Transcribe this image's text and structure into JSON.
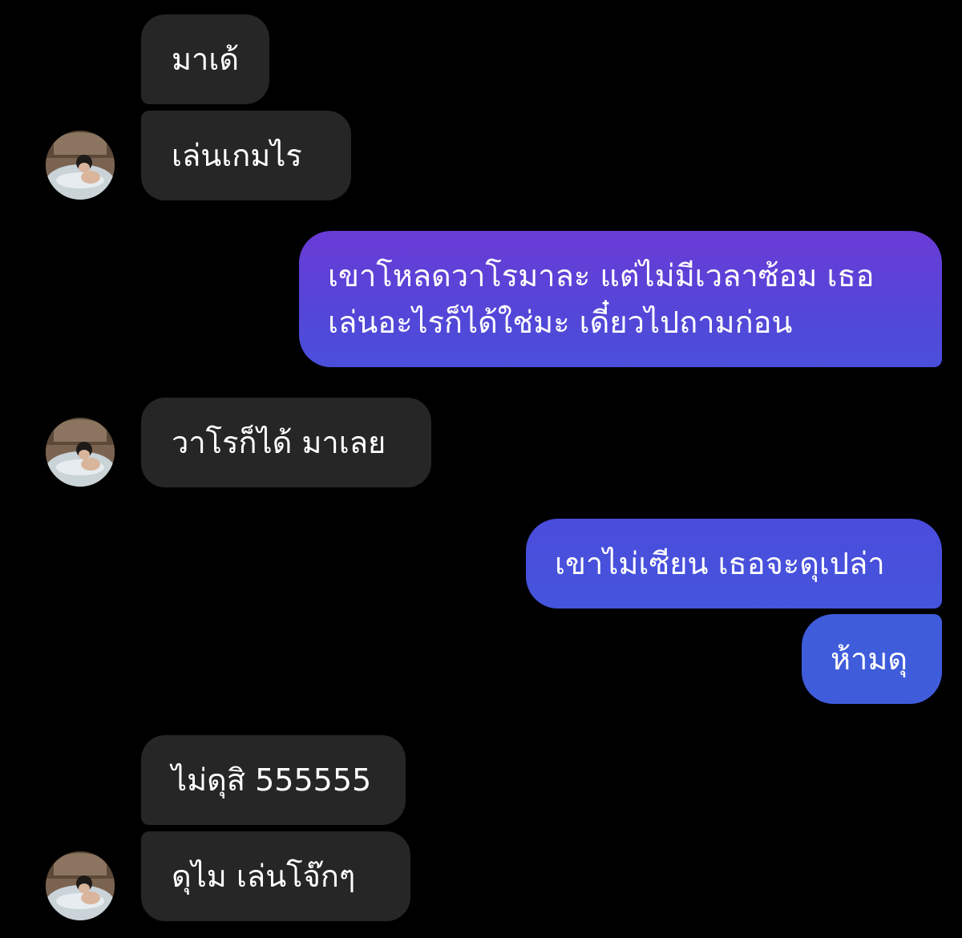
{
  "conversation": {
    "colors": {
      "background": "#000000",
      "received_bubble": "#262626",
      "sent_gradient_top": "#6a3bd6",
      "sent_gradient_bottom": "#3b5bdb",
      "text": "#ffffff"
    },
    "messages": [
      {
        "id": "m1",
        "sender": "other",
        "text": "มาเด้"
      },
      {
        "id": "m2",
        "sender": "other",
        "text": "เล่นเกมไร"
      },
      {
        "id": "m3",
        "sender": "me",
        "lines": [
          "เขาโหลดวาโรมาละ แต่ไม่มีเวลาซ้อม เธอ",
          "เล่นอะไรก็ได้ใช่มะ เดี๋ยวไปถามก่อน"
        ]
      },
      {
        "id": "m4",
        "sender": "other",
        "text": "วาโรก็ได้ มาเลย"
      },
      {
        "id": "m5",
        "sender": "me",
        "text": "เขาไม่เซียน เธอจะดุเปล่า"
      },
      {
        "id": "m6",
        "sender": "me",
        "text": "ห้ามดุ"
      },
      {
        "id": "m7",
        "sender": "other",
        "text": "ไม่ดุสิ 555555"
      },
      {
        "id": "m8",
        "sender": "other",
        "text": "ดุไม เล่นโจ๊กๆ"
      }
    ],
    "avatar_icon": "profile-photo-icon"
  }
}
